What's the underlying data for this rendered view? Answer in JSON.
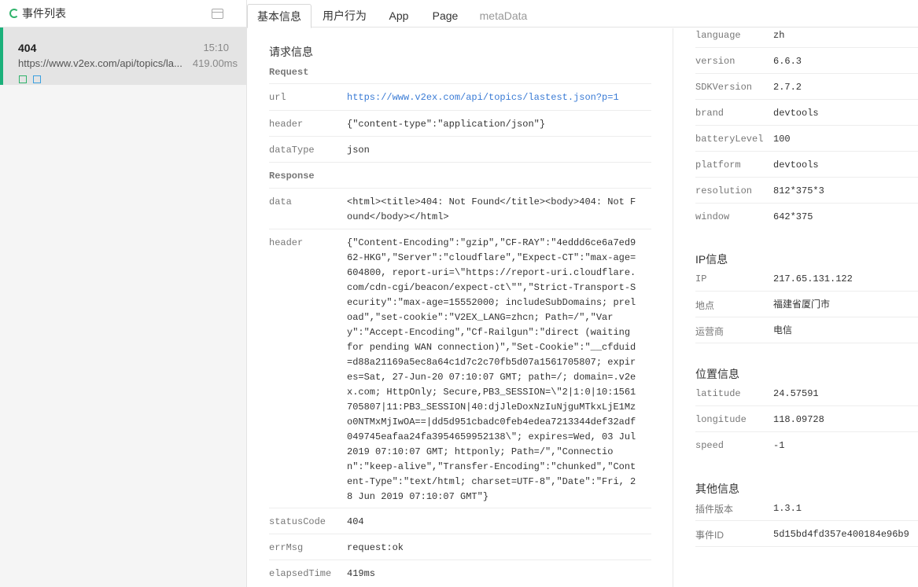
{
  "sidebar": {
    "title": "事件列表",
    "items": [
      {
        "code": "404",
        "time": "15:10",
        "url": "https://www.v2ex.com/api/topics/la...",
        "duration": "419.00ms"
      }
    ]
  },
  "tabs": [
    "基本信息",
    "用户行为",
    "App",
    "Page",
    "metaData"
  ],
  "request_section": {
    "title": "请求信息",
    "request_label": "Request",
    "url_key": "url",
    "url_value": "https://www.v2ex.com/api/topics/lastest.json?p=1",
    "header_key": "header",
    "header_value": "{\"content-type\":\"application/json\"}",
    "dataType_key": "dataType",
    "dataType_value": "json",
    "response_label": "Response",
    "data_key": "data",
    "data_value": "<html><title>404: Not Found</title><body>404: Not Found</body></html>",
    "resp_header_key": "header",
    "resp_header_value": "{\"Content-Encoding\":\"gzip\",\"CF-RAY\":\"4eddd6ce6a7ed962-HKG\",\"Server\":\"cloudflare\",\"Expect-CT\":\"max-age=604800, report-uri=\\\"https://report-uri.cloudflare.com/cdn-cgi/beacon/expect-ct\\\"\",\"Strict-Transport-Security\":\"max-age=15552000; includeSubDomains; preload\",\"set-cookie\":\"V2EX_LANG=zhcn; Path=/\",\"Vary\":\"Accept-Encoding\",\"Cf-Railgun\":\"direct (waiting for pending WAN connection)\",\"Set-Cookie\":\"__cfduid=d88a21169a5ec8a64c1d7c2c70fb5d07a1561705807; expires=Sat, 27-Jun-20 07:10:07 GMT; path=/; domain=.v2ex.com; HttpOnly; Secure,PB3_SESSION=\\\"2|1:0|10:1561705807|11:PB3_SESSION|40:djJleDoxNzIuNjguMTkxLjE1Mzo0NTMxMjIwOA==|dd5d951cbadc0feb4edea7213344def32adf049745eafaa24fa3954659952138\\\"; expires=Wed, 03 Jul 2019 07:10:07 GMT; httponly; Path=/\",\"Connection\":\"keep-alive\",\"Transfer-Encoding\":\"chunked\",\"Content-Type\":\"text/html; charset=UTF-8\",\"Date\":\"Fri, 28 Jun 2019 07:10:07 GMT\"}",
    "statusCode_key": "statusCode",
    "statusCode_value": "404",
    "errMsg_key": "errMsg",
    "errMsg_value": "request:ok",
    "elapsedTime_key": "elapsedTime",
    "elapsedTime_value": "419ms"
  },
  "device": [
    {
      "key": "language",
      "value": "zh"
    },
    {
      "key": "version",
      "value": "6.6.3"
    },
    {
      "key": "SDKVersion",
      "value": "2.7.2"
    },
    {
      "key": "brand",
      "value": "devtools"
    },
    {
      "key": "batteryLevel",
      "value": "100"
    },
    {
      "key": "platform",
      "value": "devtools"
    },
    {
      "key": "resolution",
      "value": "812*375*3"
    },
    {
      "key": "window",
      "value": "642*375"
    }
  ],
  "ip_section": {
    "title": "IP信息",
    "rows": [
      {
        "key": "IP",
        "value": "217.65.131.122"
      },
      {
        "key": "地点",
        "value": "福建省厦门市"
      },
      {
        "key": "运营商",
        "value": "电信"
      }
    ]
  },
  "location_section": {
    "title": "位置信息",
    "rows": [
      {
        "key": "latitude",
        "value": "24.57591"
      },
      {
        "key": "longitude",
        "value": "118.09728"
      },
      {
        "key": "speed",
        "value": "-1"
      }
    ]
  },
  "other_section": {
    "title": "其他信息",
    "rows": [
      {
        "key": "插件版本",
        "value": "1.3.1"
      },
      {
        "key": "事件ID",
        "value": "5d15bd4fd357e400184e96b9"
      }
    ]
  },
  "colors": {
    "accent": "#1bb07a",
    "link": "#3a7bd5",
    "selected_bg": "#e4e4e4"
  }
}
